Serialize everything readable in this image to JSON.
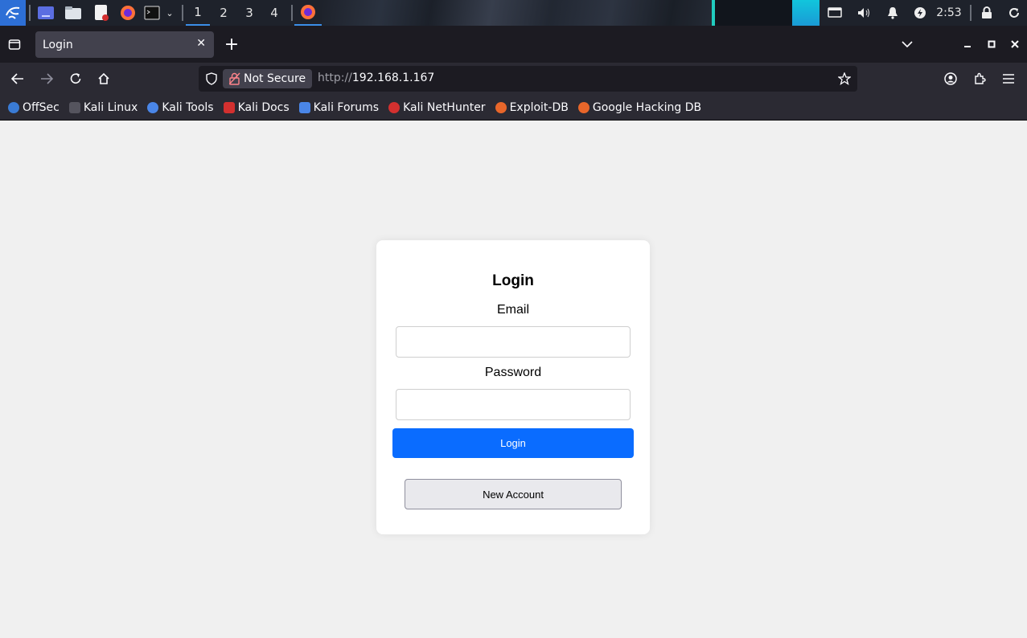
{
  "taskbar": {
    "workspaces": [
      "1",
      "2",
      "3",
      "4"
    ],
    "active_workspace": "1",
    "clock": "2:53",
    "icons": [
      "kali-menu-icon",
      "desktop-icon",
      "file-manager-icon",
      "text-editor-icon",
      "firefox-icon",
      "terminal-icon",
      "chevron-down-icon",
      "firefox-window-icon",
      "display-icon",
      "volume-icon",
      "notification-bell-icon",
      "power-icon",
      "lock-icon",
      "refresh-icon"
    ]
  },
  "browser": {
    "tab_title": "Login",
    "security_label": "Not Secure",
    "url_scheme": "http://",
    "url_host": "192.168.1.167",
    "bookmarks": [
      {
        "label": "OffSec",
        "color": "#3a7bd5"
      },
      {
        "label": "Kali Linux",
        "color": "#2b2a33"
      },
      {
        "label": "Kali Tools",
        "color": "#4a86e8"
      },
      {
        "label": "Kali Docs",
        "color": "#d3302f"
      },
      {
        "label": "Kali Forums",
        "color": "#4a86e8"
      },
      {
        "label": "Kali NetHunter",
        "color": "#d3302f"
      },
      {
        "label": "Exploit-DB",
        "color": "#e8662a"
      },
      {
        "label": "Google Hacking DB",
        "color": "#e8662a"
      }
    ]
  },
  "form": {
    "title": "Login",
    "email_label": "Email",
    "email_value": "",
    "password_label": "Password",
    "password_value": "",
    "login_button": "Login",
    "new_account_button": "New Account"
  },
  "colors": {
    "accent": "#0a6cff",
    "page_background": "#f0f0f0",
    "browser_chrome": "#2b2a33"
  }
}
